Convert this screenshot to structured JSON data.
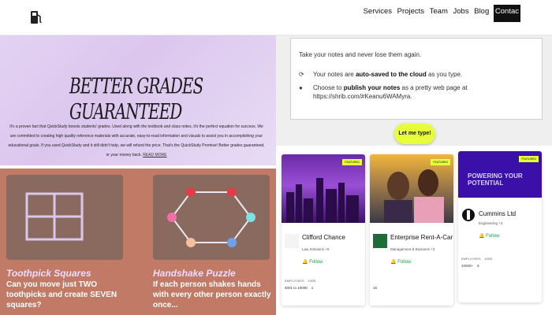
{
  "nav": {
    "items": [
      "Services",
      "Projects",
      "Team",
      "Jobs",
      "Blog"
    ],
    "contact": "Contac"
  },
  "grades": {
    "title": "BETTER GRADES GUARANTEED",
    "body": "It's a proven fact that QuickStudy boosts students' grades. Used along with the textbook and class notes, it's the perfect equation for success. We are committed to creating high quality reference materials with accurate, easy-to-read information and visuals to assist you in accomplishing your educational goals. If you used QuickStudy and it still didn't help, we will refund the price. That's the QuickStudy Promise! Better grades guaranteed, or your money back.",
    "link": "READ MORE"
  },
  "notes": {
    "tagline": "Take your notes and never lose them again.",
    "row1_a": "Your notes are ",
    "row1_b": "auto-saved to the cloud",
    "row1_c": " as you type.",
    "row2_a": "Choose to ",
    "row2_b": "publish your notes",
    "row2_c": " as a pretty web page at",
    "row2_url": "https://shrib.com/#Keanu6WAMyra.",
    "cta": "Let me type!"
  },
  "puzzles": [
    {
      "title": "Toothpick Squares",
      "desc": "Can you move just TWO toothpicks and create SEVEN squares?"
    },
    {
      "title": "Handshake Puzzle",
      "desc": "If each person shakes hands with every other person exactly once..."
    }
  ],
  "cards": [
    {
      "name": "Clifford Chance",
      "sub": "Law Solutions +9",
      "badge": "FEATURED",
      "follow": "Follow",
      "meta_label": "EMPLOYEES",
      "meta_label2": "JOBS",
      "employees": "5001 to 10000",
      "jobs": "1"
    },
    {
      "name": "Enterprise Rent-A-Car",
      "sub": "Management & Business +3",
      "badge": "FEATURED",
      "follow": "Follow",
      "employees": "15"
    },
    {
      "name": "Cummins Ltd",
      "sub": "Engineering +3",
      "badge": "FEATURED",
      "follow": "Follow",
      "meta_label": "EMPLOYEES",
      "meta_label2": "JOBS",
      "employees": "10000+",
      "jobs": "8",
      "hero_text": "POWERING YOUR POTENTIAL"
    }
  ],
  "colors": {
    "accent": "#e8ff3b",
    "follow": "#1fa14a",
    "puzzle_bg": "#c07a66",
    "grades_bg": "#dcc6ee"
  }
}
